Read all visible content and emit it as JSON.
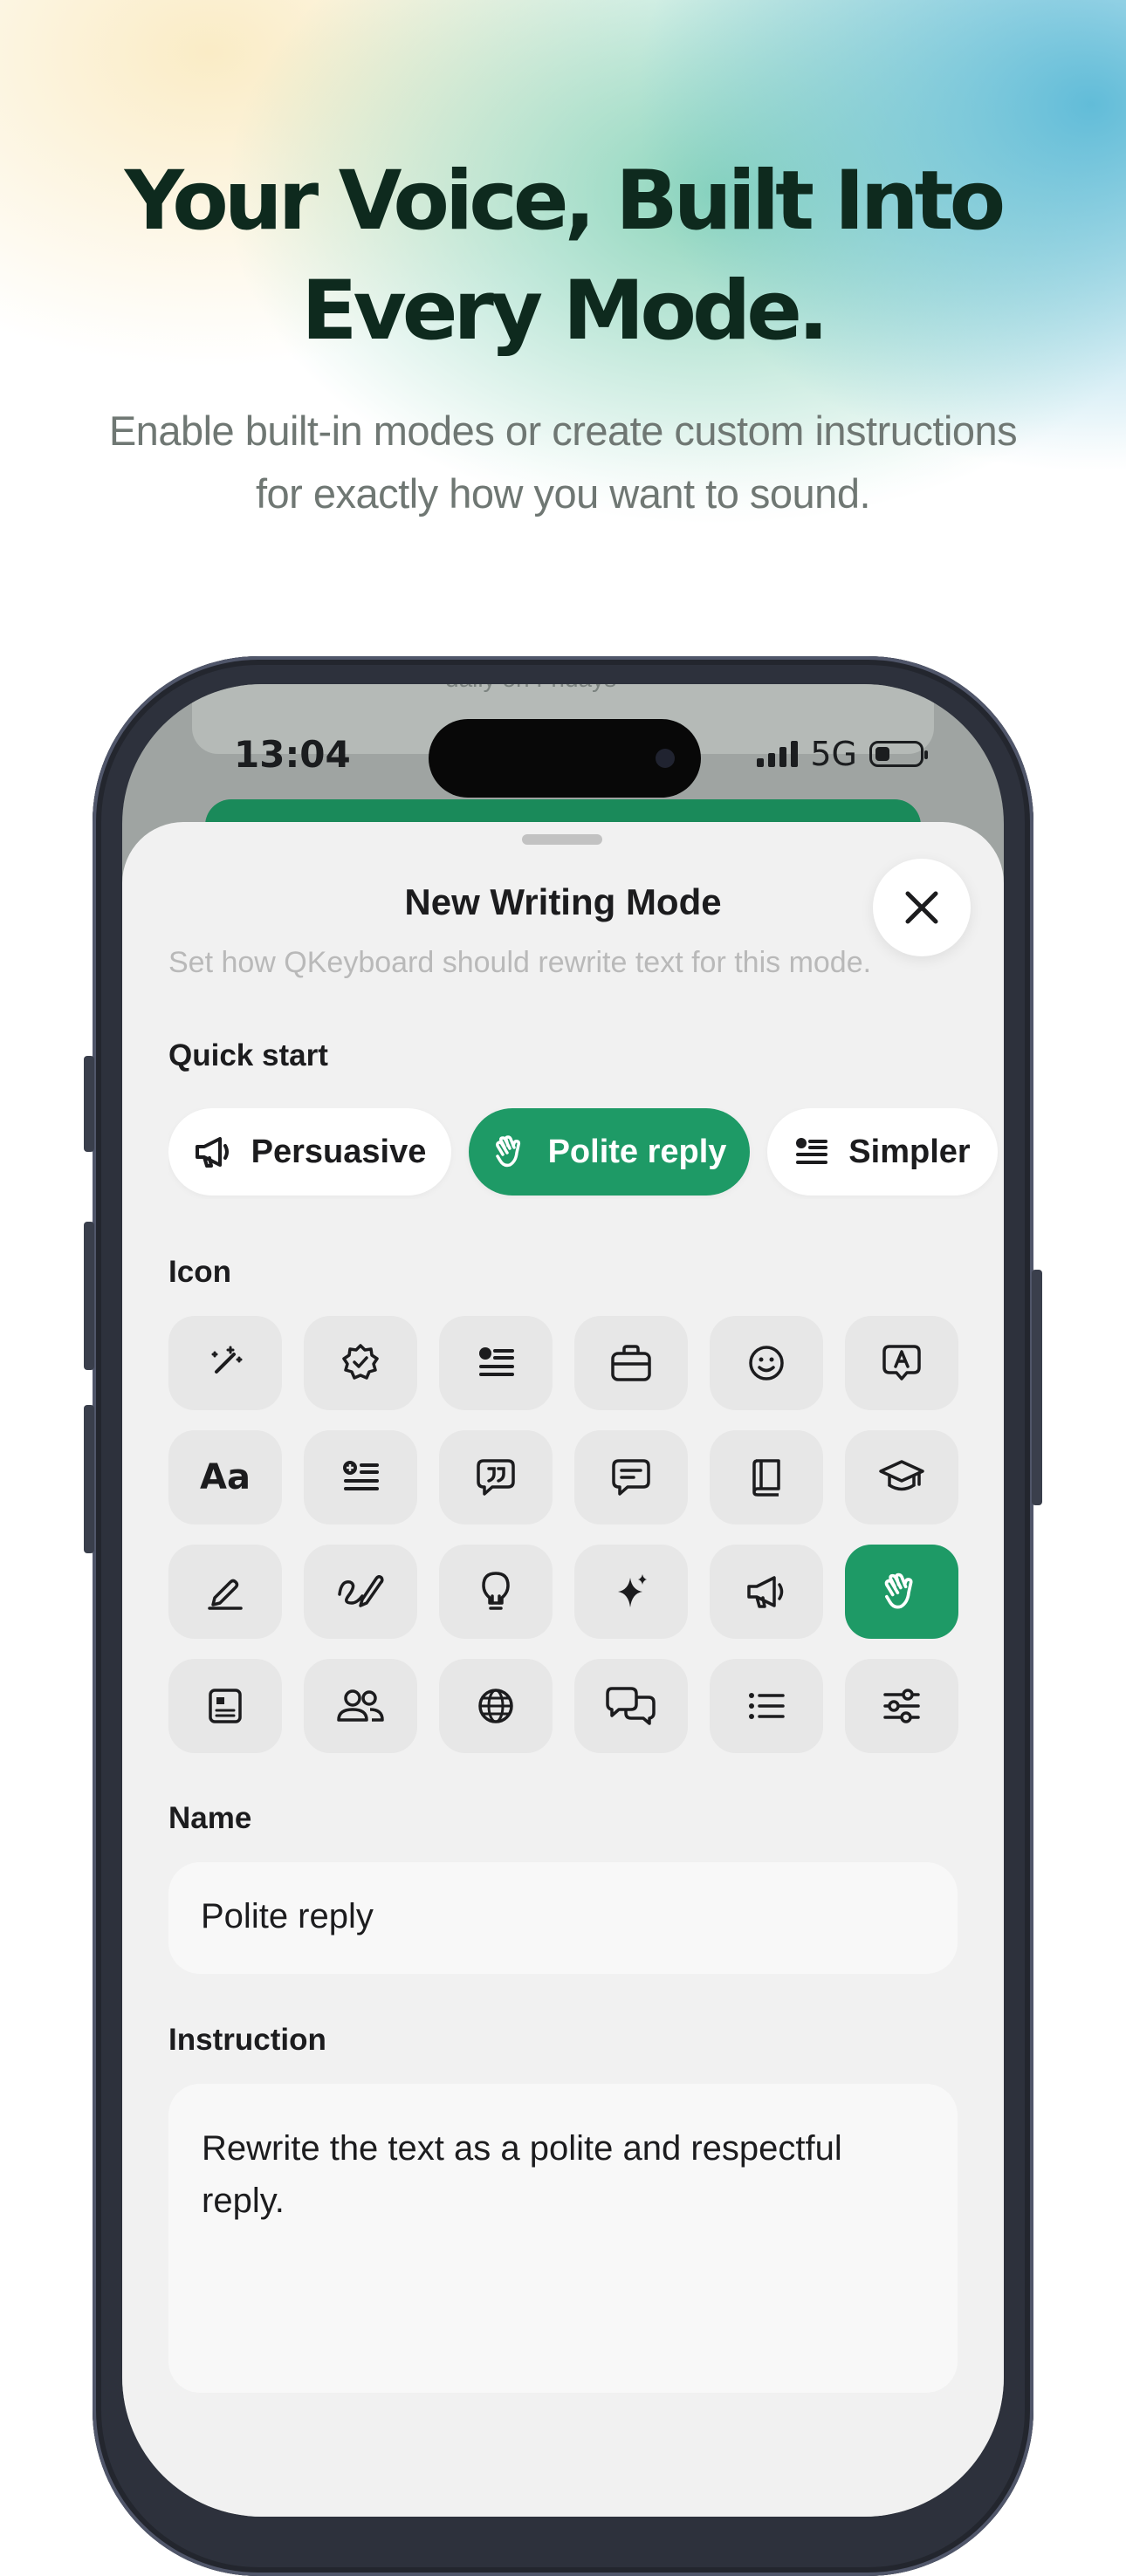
{
  "hero": {
    "title_line1": "Your Voice, Built Into",
    "title_line2": "Every Mode.",
    "subtitle_line1": "Enable built-in modes or create custom instructions",
    "subtitle_line2": "for exactly how you want to sound."
  },
  "status_bar": {
    "time": "13:04",
    "network": "5G"
  },
  "background_card": {
    "text": "daily on Fridays"
  },
  "sheet": {
    "title": "New Writing Mode",
    "subtitle": "Set how QKeyboard should rewrite text for this mode.",
    "close_icon": "close-icon",
    "quick_start_label": "Quick start",
    "quick_start": [
      {
        "label": "Persuasive",
        "icon": "megaphone-icon",
        "selected": false
      },
      {
        "label": "Polite reply",
        "icon": "waving-hand-icon",
        "selected": true
      },
      {
        "label": "Simpler",
        "icon": "simplify-icon",
        "selected": false
      }
    ],
    "icon_label": "Icon",
    "icons": [
      "magic-wand-icon",
      "verified-badge-icon",
      "text-lines-icon",
      "briefcase-icon",
      "smiley-icon",
      "letter-a-bubble-icon",
      "text-size-icon",
      "add-text-icon",
      "quote-bubble-icon",
      "message-lines-icon",
      "book-icon",
      "graduation-cap-icon",
      "pen-line-icon",
      "signature-icon",
      "lightbulb-icon",
      "sparkles-icon",
      "megaphone-icon",
      "waving-hand-icon",
      "id-card-icon",
      "people-icon",
      "globe-icon",
      "chat-bubbles-icon",
      "bullet-list-icon",
      "sliders-icon"
    ],
    "icon_text_aa": "Aa",
    "selected_icon": "waving-hand-icon",
    "name_label": "Name",
    "name_value": "Polite reply",
    "instruction_label": "Instruction",
    "instruction_value": "Rewrite the text as a polite and respectful reply."
  },
  "colors": {
    "accent": "#1e9a66",
    "headline": "#0e2a1e",
    "sheet_bg": "#f1f1f1"
  }
}
